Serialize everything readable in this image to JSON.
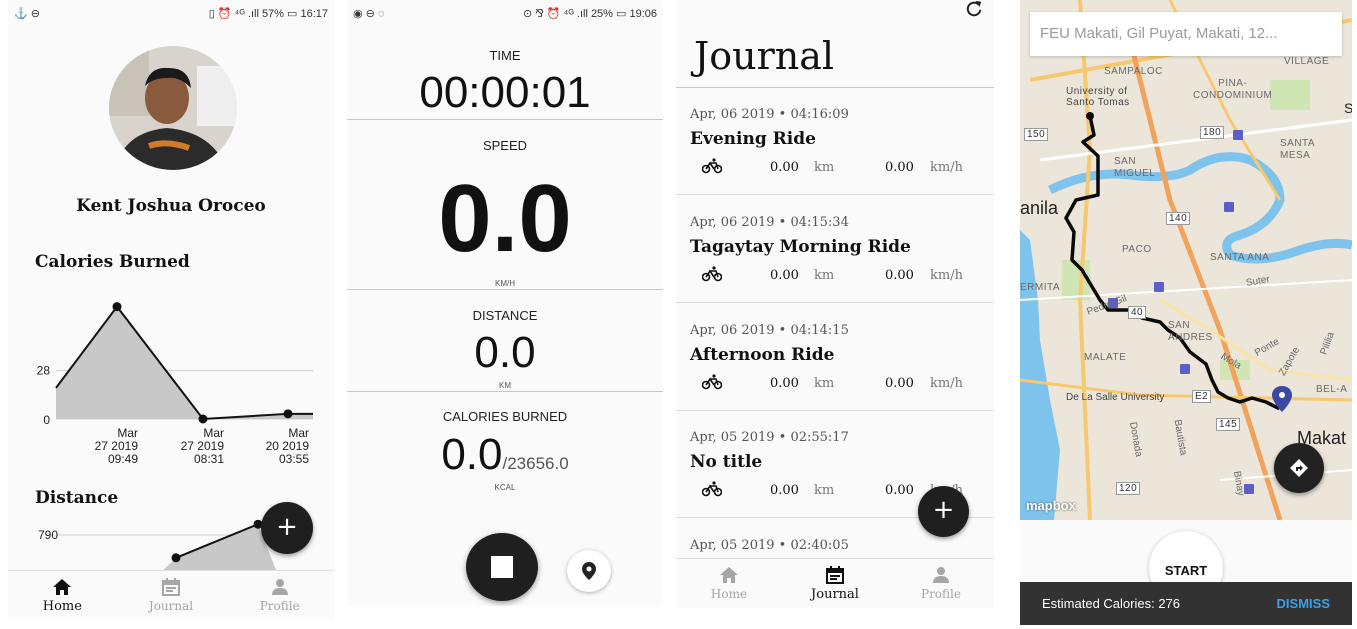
{
  "screen1": {
    "status_left": "⚓ ⊖",
    "status_right": "▯ ⏰ ⁴ᴳ .ıll 57% ▭ 16:17",
    "user_name": "Kent Joshua Oroceo",
    "calories_title": "Calories Burned",
    "distance_title": "Distance",
    "fab_label": "+",
    "nav": [
      {
        "label": "Home",
        "icon": "home-icon"
      },
      {
        "label": "Journal",
        "icon": "calendar-icon"
      },
      {
        "label": "Profile",
        "icon": "person-icon"
      }
    ]
  },
  "chart_data": [
    {
      "type": "area",
      "title": "Calories Burned",
      "x": [
        "",
        "Mar 27 2019 09:49",
        "Mar 27 2019 08:31",
        "Mar 20 2019 03:55",
        ""
      ],
      "values": [
        18,
        65,
        0,
        3,
        3
      ],
      "y_ticks": [
        "28",
        "0"
      ],
      "tick_labels": [
        {
          "l1": "Mar",
          "l2": "27 2019",
          "l3": "09:49"
        },
        {
          "l1": "Mar",
          "l2": "27 2019",
          "l3": "08:31"
        },
        {
          "l1": "Mar",
          "l2": "20 2019",
          "l3": "03:55"
        }
      ],
      "ylim": [
        0,
        70
      ],
      "grid": true
    },
    {
      "type": "area",
      "title": "Distance",
      "y_ticks": [
        "790"
      ],
      "values": [
        600,
        880
      ],
      "grid": true
    }
  ],
  "screen2": {
    "status_left": "◉ ⊖ ◌",
    "status_right": "⊙ ⅋ ⏰ ⁴ᴳ .ıll 25% ▭ 19:06",
    "time_label": "TIME",
    "time_value": "00:00:01",
    "speed_label": "SPEED",
    "speed_value": "0.0",
    "speed_unit": "KM/H",
    "distance_label": "DISTANCE",
    "distance_value": "0.0",
    "distance_unit": "KM",
    "calories_label": "CALORIES BURNED",
    "calories_value": "0.0",
    "calories_goal": "/23656.0",
    "calories_unit": "KCAL"
  },
  "screen3": {
    "title": "Journal",
    "rides": [
      {
        "date": "Apr, 06 2019  •  04:16:09",
        "title": "Evening Ride",
        "distance": "0.00",
        "distance_unit": "km",
        "speed": "0.00",
        "speed_unit": "km/h"
      },
      {
        "date": "Apr, 06 2019  •  04:15:34",
        "title": "Tagaytay Morning Ride",
        "distance": "0.00",
        "distance_unit": "km",
        "speed": "0.00",
        "speed_unit": "km/h"
      },
      {
        "date": "Apr, 06 2019  •  04:14:15",
        "title": "Afternoon Ride",
        "distance": "0.00",
        "distance_unit": "km",
        "speed": "0.00",
        "speed_unit": "km/h"
      },
      {
        "date": "Apr, 05 2019  •  02:55:17",
        "title": "No title",
        "distance": "0.00",
        "distance_unit": "km",
        "speed": "0.00",
        "speed_unit": "km/h"
      },
      {
        "date": "Apr, 05 2019  •  02:40:05",
        "title": "",
        "distance": "",
        "distance_unit": "",
        "speed": "",
        "speed_unit": ""
      }
    ],
    "fab_label": "+",
    "nav": [
      {
        "label": "Home",
        "icon": "home-icon"
      },
      {
        "label": "Journal",
        "icon": "calendar-icon"
      },
      {
        "label": "Profile",
        "icon": "person-icon"
      }
    ]
  },
  "screen4": {
    "search_placeholder": "FEU Makati, Gil Puyat, Makati, 12...",
    "map_labels": {
      "sampaloc": "SAMPALOC",
      "ust": "University of\nSanto Tomas",
      "village": "VILLAGE",
      "pina": "PINA-\nCONDOMINIUM",
      "santa_mesa": "SANTA\nMESA",
      "san_miguel": "SAN\nMIGUEL",
      "manila": "anila",
      "paco": "PACO",
      "santa_ana": "SANTA ANA",
      "ermita": "ERMITA",
      "san_andres": "SAN\nANDRES",
      "malate": "MALATE",
      "dlsu": "De La Salle University",
      "makati": "Makat",
      "bel_a": "BEL-A",
      "pedro_gil": "Pedro Gil",
      "ponte": "Ponte",
      "mola": "Mola",
      "zapote": "Zapote",
      "suter": "Suter",
      "pililia": "Pililia",
      "donada": "Donada",
      "bautista": "Bautista",
      "binay": "Binay",
      "road_150": "150",
      "road_180": "180",
      "road_140": "140",
      "road_145": "145",
      "road_120": "120",
      "road_e2": "E2",
      "road_40": "40",
      "road_s": "S"
    },
    "mapbox": "mapbox",
    "start_label": "START",
    "snackbar_text": "Estimated Calories: 276",
    "dismiss_label": "DISMISS"
  }
}
